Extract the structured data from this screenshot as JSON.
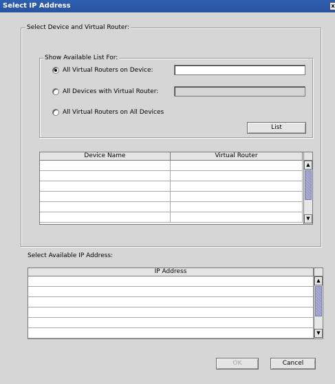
{
  "window": {
    "title": "Select IP Address",
    "close_glyph": "x"
  },
  "device_group": {
    "legend": "Select Device and Virtual Router:",
    "show_group": {
      "legend": "Show Available List For:",
      "options": [
        {
          "label": "All Virtual Routers on Device:",
          "selected": true,
          "field_value": "",
          "field_enabled": true
        },
        {
          "label": "All Devices with Virtual Router:",
          "selected": false,
          "field_value": "",
          "field_enabled": false
        },
        {
          "label": "All Virtual Routers on All Devices",
          "selected": false
        }
      ],
      "list_button": "List"
    },
    "table": {
      "columns": [
        "Device Name",
        "Virtual Router"
      ],
      "rows": [
        [
          "",
          ""
        ],
        [
          "",
          ""
        ],
        [
          "",
          ""
        ],
        [
          "",
          ""
        ],
        [
          "",
          ""
        ],
        [
          "",
          ""
        ]
      ]
    }
  },
  "ip_section": {
    "label": "Select Available IP Address:",
    "table": {
      "columns": [
        "IP Address"
      ],
      "rows": [
        [
          ""
        ],
        [
          ""
        ],
        [
          ""
        ],
        [
          ""
        ],
        [
          ""
        ],
        [
          ""
        ]
      ]
    }
  },
  "footer": {
    "ok": "OK",
    "cancel": "Cancel",
    "ok_enabled": false
  },
  "colors": {
    "titlebar": "#2f5fb0",
    "background": "#d6d6d6",
    "scroll_thumb": "#9c9cc8"
  }
}
